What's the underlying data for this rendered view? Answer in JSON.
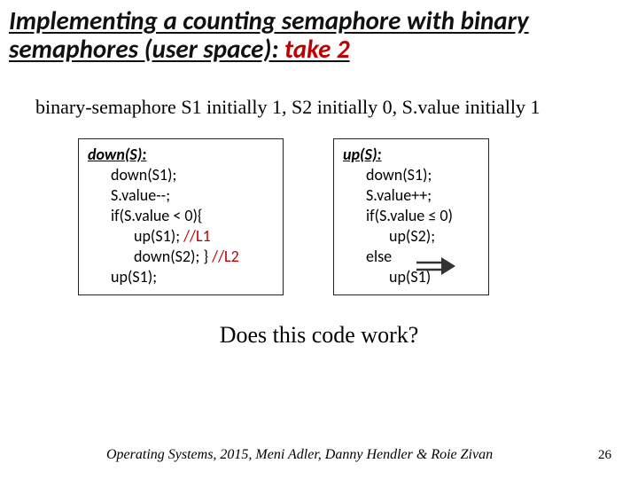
{
  "title": {
    "line": "Implementing a counting semaphore with binary semaphores (user space): ",
    "take2": "take 2"
  },
  "init": "binary-semaphore S1 initially 1, S2 initially 0,  S.value initially 1",
  "down": {
    "hdr": "down(S):",
    "l1": "down(S1);",
    "l2": "S.value--;",
    "l3": "if(S.value < 0){",
    "l4a": "up(S1); ",
    "l4b": "//L1",
    "l5a": "down(S2); } ",
    "l5b": "//L2",
    "l6": "up(S1);"
  },
  "up": {
    "hdr": "up(S):",
    "l1": "down(S1);",
    "l2": "S.value++;",
    "l3": "if(S.value ≤ 0)",
    "l4": "up(S2);",
    "l5": "else",
    "l6": "up(S1)"
  },
  "question": "Does this code work?",
  "credits": "Operating Systems, 2015, Meni Adler, Danny Hendler & Roie Zivan",
  "page": "26"
}
